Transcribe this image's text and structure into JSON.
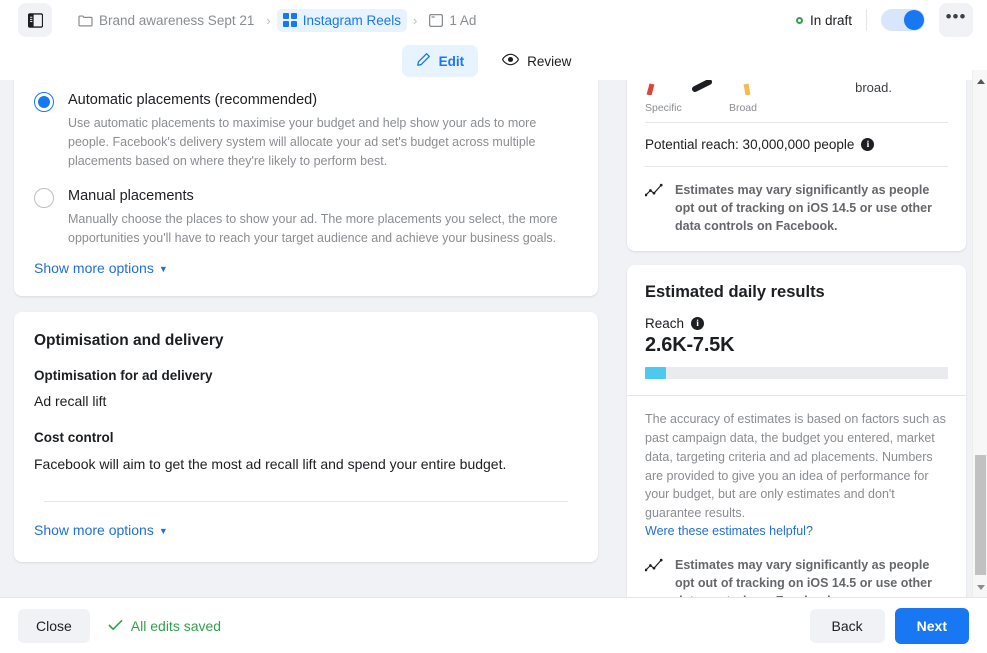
{
  "topbar": {
    "panel_toggle_icon": "sidebar-panel-icon",
    "breadcrumb": [
      {
        "label": "Brand awareness Sept 21",
        "icon": "folder-icon",
        "active": false
      },
      {
        "label": "Instagram Reels",
        "icon": "grid-squares-icon",
        "active": true
      },
      {
        "label": "1 Ad",
        "icon": "window-icon",
        "active": false
      }
    ],
    "separator": "›",
    "status": "In draft",
    "status_color": "#31a24c",
    "toggle_on": true,
    "more_label": "•••"
  },
  "tabs": [
    {
      "label": "Edit",
      "icon": "pencil-icon",
      "selected": true
    },
    {
      "label": "Review",
      "icon": "eye-icon",
      "selected": false
    }
  ],
  "placements": {
    "options": [
      {
        "title": "Automatic placements (recommended)",
        "description": "Use automatic placements to maximise your budget and help show your ads to more people. Facebook's delivery system will allocate your ad set's budget across multiple placements based on where they're likely to perform best.",
        "selected": true
      },
      {
        "title": "Manual placements",
        "description": "Manually choose the places to show your ad. The more placements you select, the more opportunities you'll have to reach your target audience and achieve your business goals.",
        "selected": false
      }
    ],
    "show_more": "Show more options"
  },
  "optimisation": {
    "section_title": "Optimisation and delivery",
    "field_label": "Optimisation for ad delivery",
    "field_value": "Ad recall lift",
    "cost_label": "Cost control",
    "cost_value": "Facebook will aim to get the most ad recall lift and spend your entire budget.",
    "show_more": "Show more options"
  },
  "audience": {
    "gauge_specific": "Specific",
    "gauge_broad": "Broad",
    "cut_text": "broad.",
    "potential_reach": "Potential reach: 30,000,000 people",
    "info_icon": "info-icon",
    "disclaimer": "Estimates may vary significantly as people opt out of tracking on iOS 14.5 or use other data controls on Facebook.",
    "disclaimer_icon": "chart-line-icon"
  },
  "estimated": {
    "title": "Estimated daily results",
    "reach_label": "Reach",
    "reach_value": "2.6K-7.5K",
    "bar_fill_percent": 7,
    "bar_fill_color": "#4dc8ef",
    "accuracy_text": "The accuracy of estimates is based on factors such as past campaign data, the budget you entered, market data, targeting criteria and ad placements. Numbers are provided to give you an idea of performance for your budget, but are only estimates and don't guarantee results.",
    "feedback_link": "Were these estimates helpful?",
    "disclaimer": "Estimates may vary significantly as people opt out of tracking on iOS 14.5 or use other data controls on Facebook.",
    "disclaimer_icon": "chart-line-icon"
  },
  "footer": {
    "close_label": "Close",
    "saved_label": "All edits saved",
    "saved_icon": "check-icon",
    "back_label": "Back",
    "next_label": "Next"
  }
}
